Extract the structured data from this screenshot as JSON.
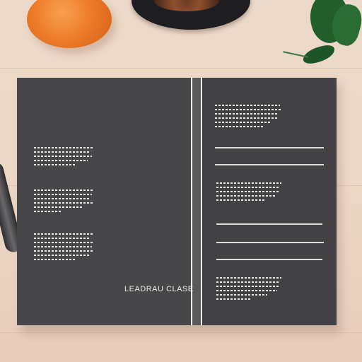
{
  "scene": {
    "surface": "wooden-table",
    "background_color": "#ecd8c8"
  },
  "objects": {
    "orange_color": "#ee7d2a",
    "plate_color": "#1e1d22",
    "leaves_color": "#225e2c"
  },
  "brochure": {
    "panel_color": "#47474a",
    "brand_text": "LEADRAU CLASE"
  }
}
